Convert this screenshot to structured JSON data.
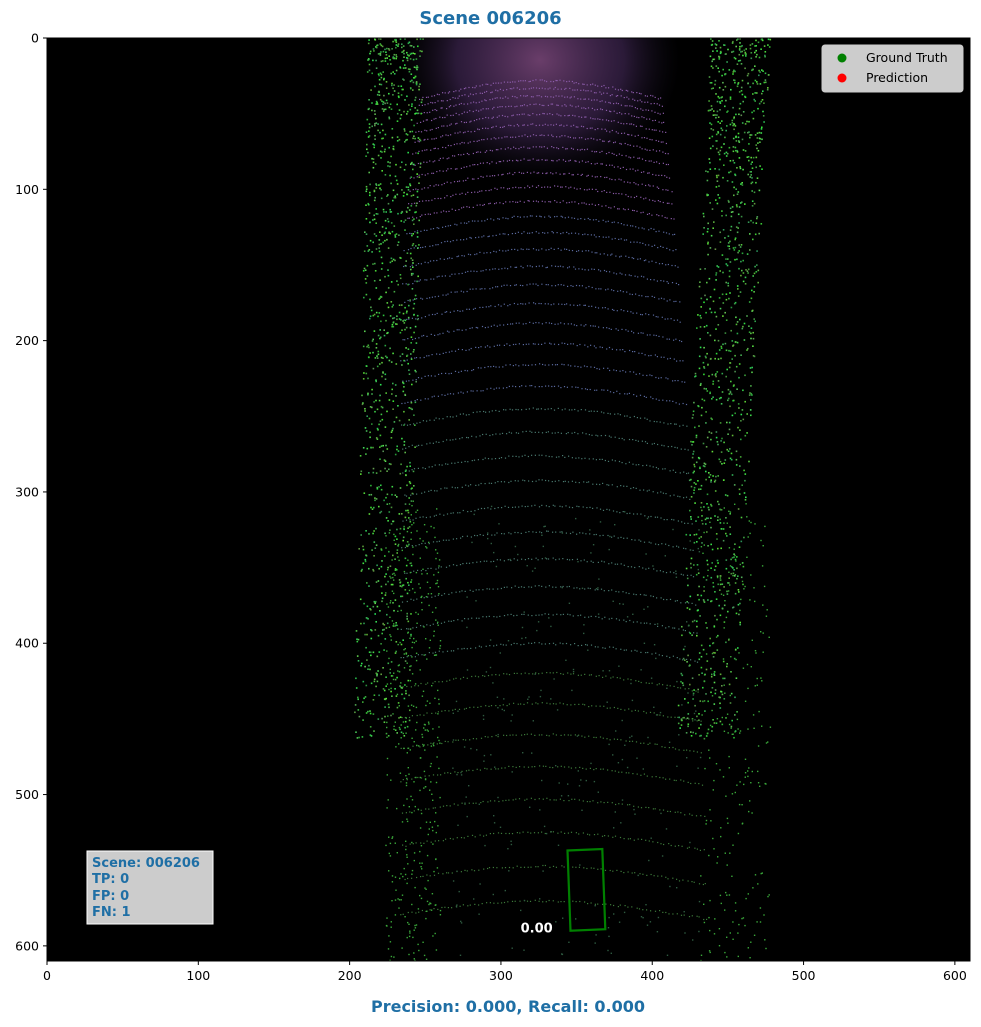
{
  "title": "Scene 006206",
  "footer": "Precision: 0.000, Recall: 0.000",
  "legend": [
    {
      "label": "Ground Truth",
      "color": "#008000"
    },
    {
      "label": "Prediction",
      "color": "#ff0000"
    }
  ],
  "stats_box": {
    "lines": [
      "Scene: 006206",
      "TP: 0",
      "FP: 0",
      "FN: 1"
    ],
    "color": "#1f6fa5"
  },
  "chart_data": {
    "type": "scatter",
    "title": "Scene 006206",
    "background": "#000000",
    "xlim": [
      0,
      610
    ],
    "ylim": [
      610,
      0
    ],
    "x_ticks": [
      0,
      100,
      200,
      300,
      400,
      500,
      600
    ],
    "y_ticks": [
      0,
      100,
      200,
      300,
      400,
      500,
      600
    ],
    "grid": false,
    "legend_position": "top-right",
    "ground_truth_boxes": [
      {
        "corners": [
          [
            344,
            537
          ],
          [
            367,
            536
          ],
          [
            369,
            589
          ],
          [
            346,
            590
          ]
        ],
        "color": "#008000"
      }
    ],
    "predictions": [],
    "annotations": [
      {
        "text": "0.00",
        "x": 313,
        "y": 588,
        "color": "#ffffff"
      }
    ]
  }
}
